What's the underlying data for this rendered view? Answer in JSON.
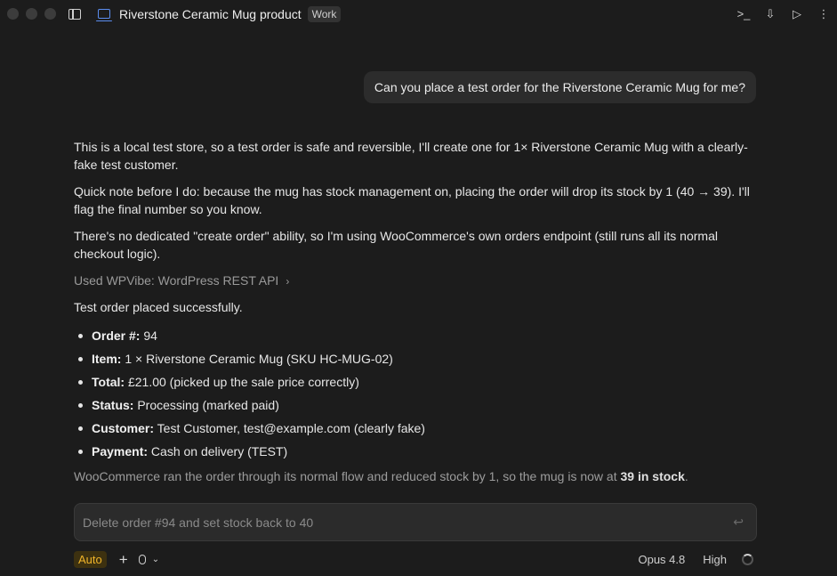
{
  "window": {
    "title": "Riverstone Ceramic Mug product",
    "tag": "Work"
  },
  "toolbar": {
    "terminal_glyph": ">_",
    "preview_glyph": "⇩",
    "run_glyph": "▷",
    "more_glyph": "⋮"
  },
  "conversation": {
    "user_message": "Can you place a test order for the Riverstone Ceramic Mug for me?",
    "assistant": {
      "p1": "This is a local test store, so a test order is safe and reversible, I'll create one for 1× Riverstone Ceramic Mug with a clearly-fake test customer.",
      "p2": "Quick note before I do: because the mug has stock management on, placing the order will drop its stock by 1 (40 → 39). I'll flag the final number so you know.",
      "p3": "There's no dedicated \"create order\" ability, so I'm using WooCommerce's own orders endpoint (still runs all its normal checkout logic).",
      "tool_use": "Used WPVibe: WordPress REST API",
      "tool_chevron": "›",
      "p4": "Test order placed successfully.",
      "details": [
        {
          "label": "Order #:",
          "value": " 94"
        },
        {
          "label": "Item:",
          "value": " 1 × Riverstone Ceramic Mug (SKU HC-MUG-02)"
        },
        {
          "label": "Total:",
          "value": " £21.00 (picked up the sale price correctly)"
        },
        {
          "label": "Status:",
          "value": " Processing (marked paid)"
        },
        {
          "label": "Customer:",
          "value": " Test Customer, test@example.com (clearly fake)"
        },
        {
          "label": "Payment:",
          "value": " Cash on delivery (TEST)"
        }
      ],
      "p5_before": "WooCommerce ran the order through its normal flow and reduced stock by 1, so the mug is now at ",
      "p5_bold": "39 in stock",
      "p5_after": "."
    }
  },
  "composer": {
    "placeholder": "Delete order #94 and set stock back to 40",
    "enter_glyph": "↩",
    "mode": "Auto",
    "plus_glyph": "+",
    "chevron_glyph": "⌄",
    "model": "Opus 4.8",
    "effort": "High"
  },
  "colors": {
    "background": "#1c1c1c",
    "accent": "#5b8def",
    "auto_badge": "#f0b429"
  }
}
